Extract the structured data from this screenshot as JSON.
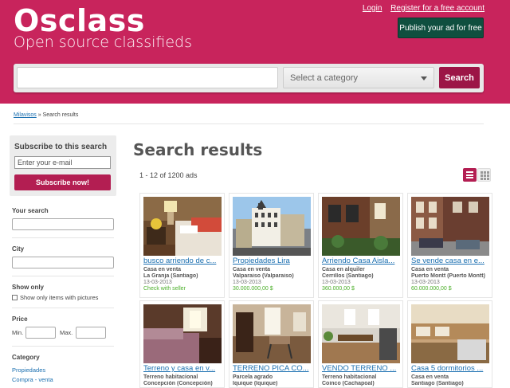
{
  "header": {
    "logo": "Osclass",
    "tagline": "Open source classifieds",
    "login_link": "Login",
    "register_link": "Register for a free account",
    "publish_button": "Publish your ad for free",
    "bg_color": "#c8245c"
  },
  "search": {
    "input_value": "",
    "category_placeholder": "Select a category",
    "button": "Search"
  },
  "breadcrumb": {
    "home": "Milavisos",
    "separator": "»",
    "current": "Search results"
  },
  "sidebar": {
    "subscribe_title": "Subscribe to this search",
    "email_placeholder": "Enter your e-mail",
    "subscribe_button": "Subscribe now!",
    "your_search_label": "Your search",
    "city_label": "City",
    "show_only_label": "Show only",
    "pictures_checkbox": "Show only items with pictures",
    "price_label": "Price",
    "min_label": "Min.",
    "max_label": "Max.",
    "category_label": "Category",
    "categories": [
      "Propiedades",
      "Compra - venta"
    ]
  },
  "main": {
    "title": "Search results",
    "count": "1 - 12 of 1200 ads",
    "listings": [
      {
        "title": "busco arriendo de c...",
        "category": "Casa en venta",
        "location": "La Granja (Santiago)",
        "date": "13-03-2013",
        "price": "",
        "seller": "Check with seller"
      },
      {
        "title": "Propiedades Lira",
        "category": "Casa en venta",
        "location": "Valparaiso (Valparaiso)",
        "date": "13-03-2013",
        "price": "30.000.000,00 $",
        "seller": ""
      },
      {
        "title": "Arriendo Casa Aisla...",
        "category": "Casa en alquiler",
        "location": "Cerrillos (Santiago)",
        "date": "13-03-2013",
        "price": "360.000,00 $",
        "seller": ""
      },
      {
        "title": "Se vende casa en e...",
        "category": "Casa en venta",
        "location": "Puerto Montt (Puerto Montt)",
        "date": "13-03-2013",
        "price": "60.000.000,00 $",
        "seller": ""
      },
      {
        "title": "Terreno y casa en v...",
        "category": "Terreno habitacional",
        "location": "Concepción (Concepción)",
        "date": "",
        "price": "",
        "seller": ""
      },
      {
        "title": "TERRENO PICA CO...",
        "category": "Parcela agrado",
        "location": "Iquique (Iquique)",
        "date": "",
        "price": "",
        "seller": ""
      },
      {
        "title": "VENDO TERRENO ...",
        "category": "Terreno habitacional",
        "location": "Coinco (Cachapoal)",
        "date": "",
        "price": "",
        "seller": ""
      },
      {
        "title": "Casa 5 dormitorios ...",
        "category": "Casa en venta",
        "location": "Santiago (Santiago)",
        "date": "",
        "price": "",
        "seller": ""
      }
    ]
  }
}
